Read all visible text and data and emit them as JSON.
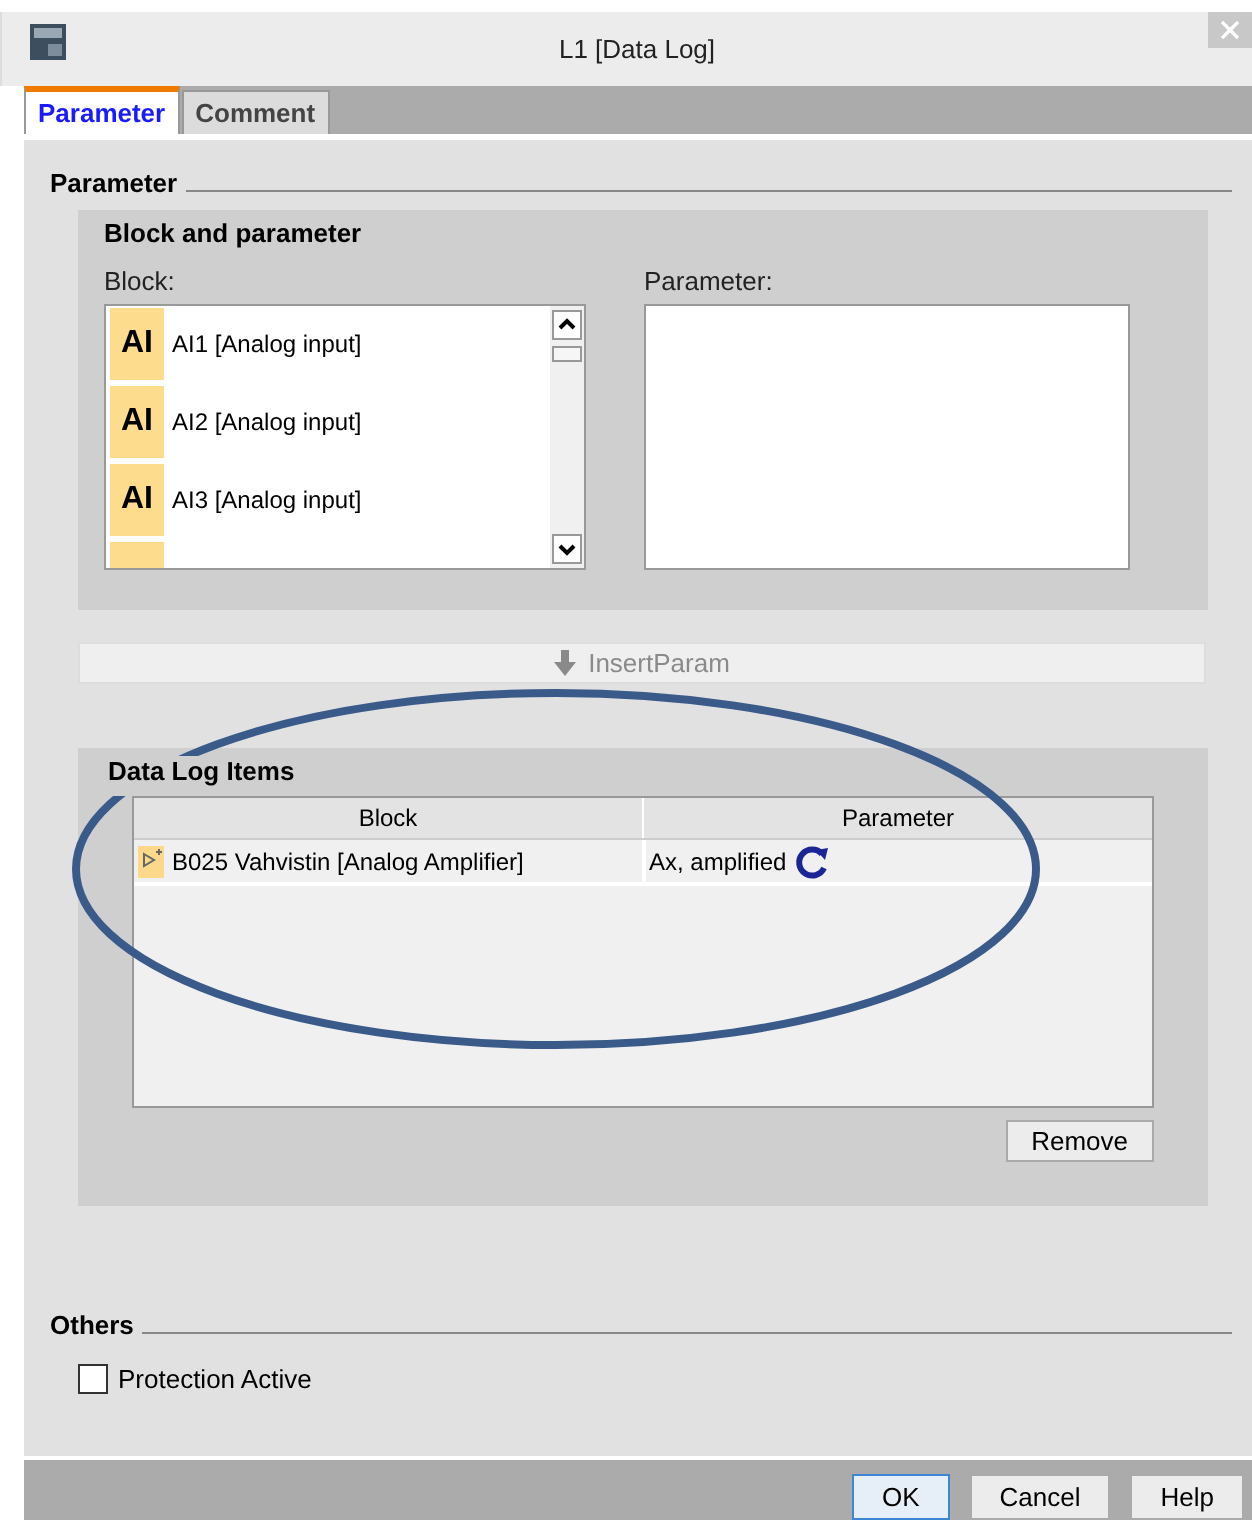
{
  "window": {
    "title": "L1 [Data Log]"
  },
  "tabs": [
    {
      "label": "Parameter",
      "selected": true
    },
    {
      "label": "Comment",
      "selected": false
    }
  ],
  "parameter_section": {
    "heading": "Parameter",
    "block_and_parameter": {
      "title": "Block and parameter",
      "block_label": "Block:",
      "parameter_label": "Parameter:",
      "blocks": [
        {
          "badge": "AI",
          "label": "AI1 [Analog input]"
        },
        {
          "badge": "AI",
          "label": "AI2 [Analog input]"
        },
        {
          "badge": "AI",
          "label": "AI3 [Analog input]"
        }
      ]
    },
    "insert_button": {
      "label": "InsertParam",
      "disabled": true
    },
    "data_log_items": {
      "title": "Data Log Items",
      "columns": [
        "Block",
        "Parameter"
      ],
      "rows": [
        {
          "block": "B025 Vahvistin [Analog Amplifier]",
          "parameter": "Ax, amplified"
        }
      ],
      "remove_button": "Remove"
    }
  },
  "others": {
    "heading": "Others",
    "checkbox": {
      "label": "Protection Active",
      "checked": false
    }
  },
  "buttons": [
    {
      "label": "OK",
      "focused": true
    },
    {
      "label": "Cancel",
      "focused": false
    },
    {
      "label": "Help",
      "focused": false
    }
  ]
}
